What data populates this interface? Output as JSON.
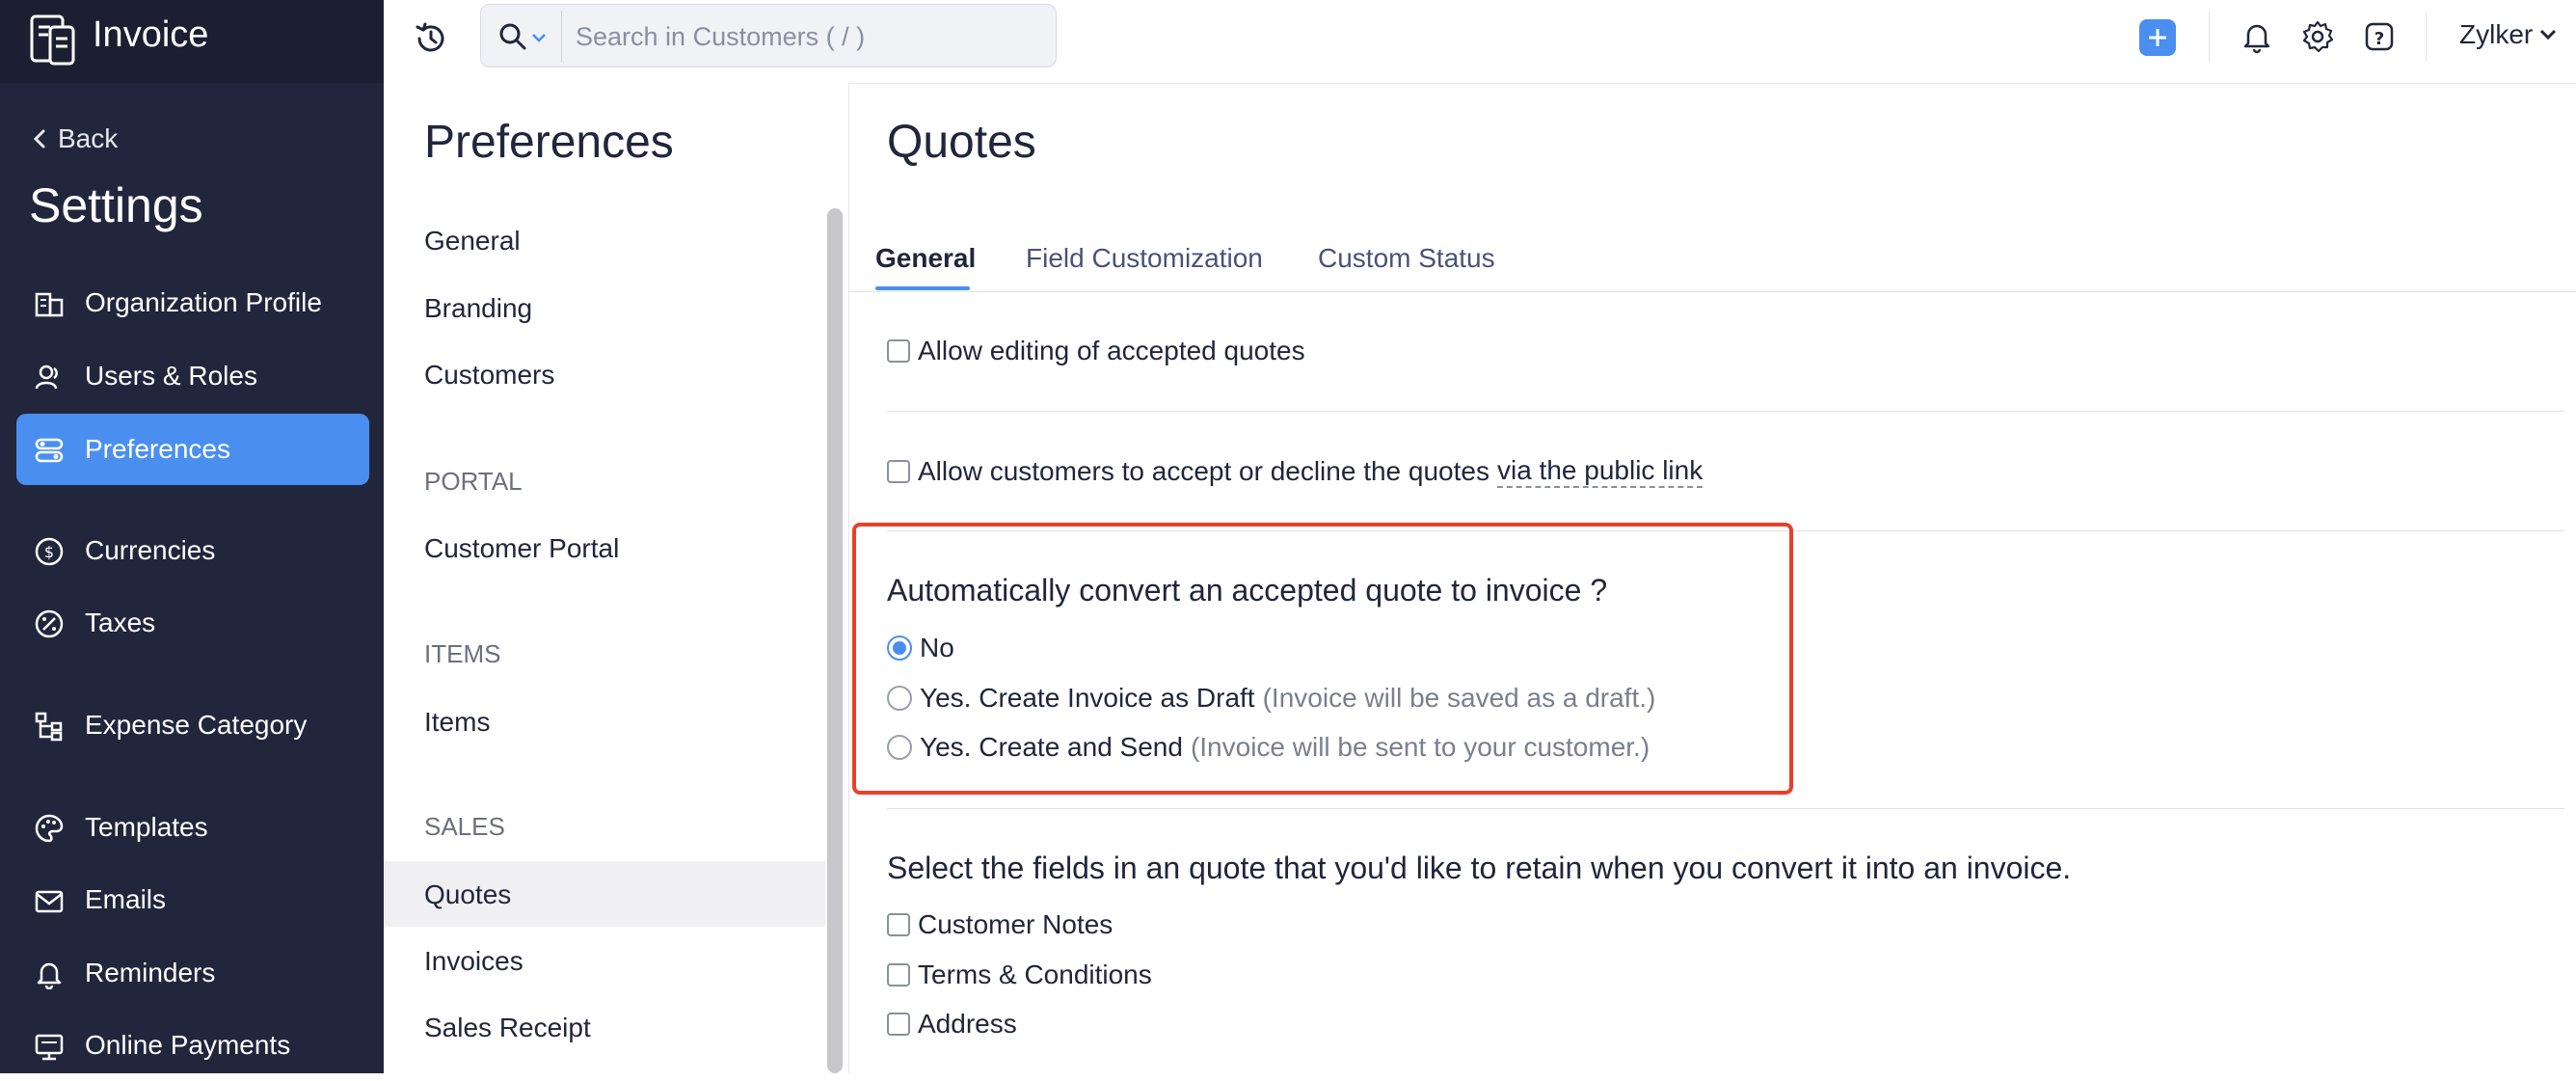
{
  "app": {
    "title": "Invoice"
  },
  "sidebar": {
    "back_label": "Back",
    "section_title": "Settings",
    "items": [
      {
        "label": "Organization Profile",
        "icon": "building-icon"
      },
      {
        "label": "Users & Roles",
        "icon": "users-icon"
      },
      {
        "label": "Preferences",
        "icon": "preferences-icon",
        "active": true
      },
      {
        "label": "Currencies",
        "icon": "currency-icon"
      },
      {
        "label": "Taxes",
        "icon": "tax-icon"
      },
      {
        "label": "Expense Category",
        "icon": "category-icon"
      },
      {
        "label": "Templates",
        "icon": "palette-icon"
      },
      {
        "label": "Emails",
        "icon": "email-icon"
      },
      {
        "label": "Reminders",
        "icon": "bell-icon"
      },
      {
        "label": "Online Payments",
        "icon": "payment-icon"
      }
    ]
  },
  "topbar": {
    "search_placeholder": "Search in Customers ( / )",
    "user_name": "Zylker"
  },
  "preferences": {
    "title": "Preferences",
    "items_top": [
      "General",
      "Branding",
      "Customers"
    ],
    "sections": [
      {
        "title": "PORTAL",
        "items": [
          "Customer Portal"
        ]
      },
      {
        "title": "ITEMS",
        "items": [
          "Items"
        ]
      },
      {
        "title": "SALES",
        "items": [
          "Quotes",
          "Invoices",
          "Sales Receipt"
        ]
      }
    ],
    "active_item": "Quotes"
  },
  "main": {
    "title": "Quotes",
    "tabs": [
      "General",
      "Field Customization",
      "Custom Status"
    ],
    "active_tab": "General",
    "options": {
      "allow_editing": {
        "label": "Allow editing of accepted quotes",
        "checked": false
      },
      "allow_accept": {
        "label": "Allow customers to accept or decline the quotes",
        "link": "via the public link",
        "checked": false
      }
    },
    "convert": {
      "question": "Automatically convert an accepted quote to invoice ?",
      "options": [
        {
          "label": "No",
          "hint": "",
          "selected": true
        },
        {
          "label": "Yes. Create Invoice as Draft",
          "hint": "(Invoice will be saved as a draft.)",
          "selected": false
        },
        {
          "label": "Yes. Create and Send",
          "hint": "(Invoice will be sent to your customer.)",
          "selected": false
        }
      ]
    },
    "retain": {
      "question": "Select the fields in an quote that you'd like to retain when you convert it into an invoice.",
      "fields": [
        "Customer Notes",
        "Terms & Conditions",
        "Address"
      ]
    }
  },
  "colors": {
    "accent": "#4a8ff0",
    "sidebar_bg": "#21263c",
    "highlight": "#e8402c"
  }
}
